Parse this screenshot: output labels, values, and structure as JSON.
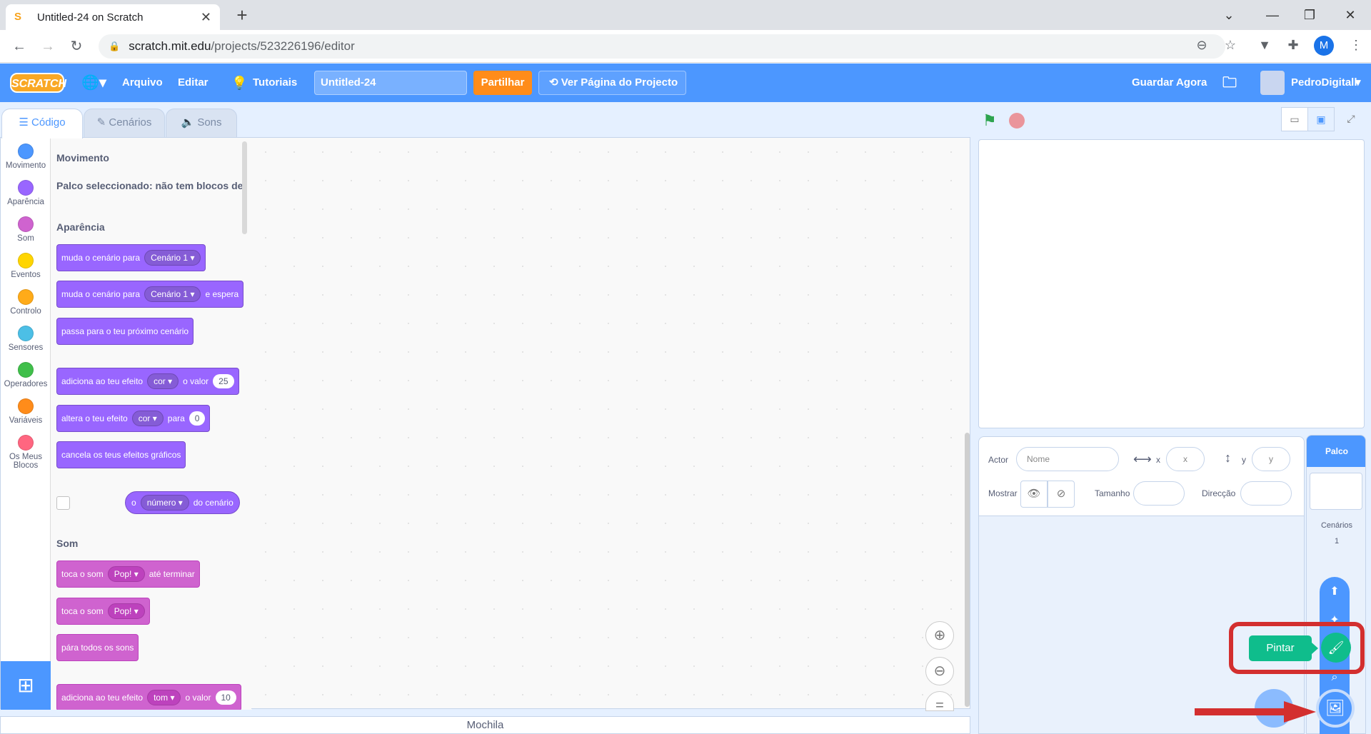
{
  "browser": {
    "tab_title": "Untitled-24 on Scratch",
    "url_host": "scratch.mit.edu",
    "url_path": "/projects/523226196/editor",
    "profile_initial": "M"
  },
  "menubar": {
    "logo": "SCRATCH",
    "file": "Arquivo",
    "edit": "Editar",
    "tutorials": "Tutoriais",
    "project_title": "Untitled-24",
    "share": "Partilhar",
    "see_project": "Ver Página do Projecto",
    "save_now": "Guardar Agora",
    "username": "PedroDigitall"
  },
  "editor_tabs": {
    "code": "Código",
    "backdrops": "Cenários",
    "sounds": "Sons"
  },
  "categories": [
    {
      "label": "Movimento",
      "color": "#4c97ff"
    },
    {
      "label": "Aparência",
      "color": "#9966ff"
    },
    {
      "label": "Som",
      "color": "#cf63cf"
    },
    {
      "label": "Eventos",
      "color": "#ffd500"
    },
    {
      "label": "Controlo",
      "color": "#ffab19"
    },
    {
      "label": "Sensores",
      "color": "#4cbfe6"
    },
    {
      "label": "Operadores",
      "color": "#40bf4a"
    },
    {
      "label": "Variáveis",
      "color": "#ff8c1a"
    },
    {
      "label": "Os Meus Blocos",
      "color": "#ff6680"
    }
  ],
  "palette": {
    "motion_title": "Movimento",
    "motion_note": "Palco seleccionado: não tem blocos de",
    "looks_title": "Aparência",
    "sound_title": "Som",
    "blocks": {
      "switch_backdrop": "muda o cenário para",
      "backdrop1": "Cenário 1",
      "switch_backdrop_wait_suffix": "e espera",
      "next_backdrop": "passa para o teu próximo cenário",
      "change_effect": "adiciona ao teu efeito",
      "effect_color": "cor",
      "by_value": "o valor",
      "change_value": "25",
      "set_effect": "altera o teu efeito",
      "to": "para",
      "set_value": "0",
      "clear_effects": "cancela os teus efeitos gráficos",
      "reporter_o": "o",
      "reporter_number": "número",
      "reporter_suffix": "do cenário",
      "play_sound": "toca o som",
      "sound_pop": "Pop!",
      "until_done": "até terminar",
      "stop_sounds": "pára todos os sons",
      "effect_pitch": "tom",
      "pitch_value": "10"
    }
  },
  "workspace": {
    "backpack": "Mochila"
  },
  "sprite_info": {
    "sprite_label": "Actor",
    "name_placeholder": "Nome",
    "x_label": "x",
    "x_placeholder": "x",
    "y_label": "y",
    "y_placeholder": "y",
    "show_label": "Mostrar",
    "size_label": "Tamanho",
    "direction_label": "Direcção"
  },
  "stage_panel": {
    "header": "Palco",
    "backdrops_label": "Cenários",
    "backdrops_count": "1"
  },
  "add_backdrop": {
    "tooltip": "Pintar"
  },
  "colors": {
    "menu_blue": "#4c97ff",
    "share_orange": "#ff8c1a",
    "paint_green": "#0fbd8c",
    "highlight_red": "#d32f2f"
  }
}
